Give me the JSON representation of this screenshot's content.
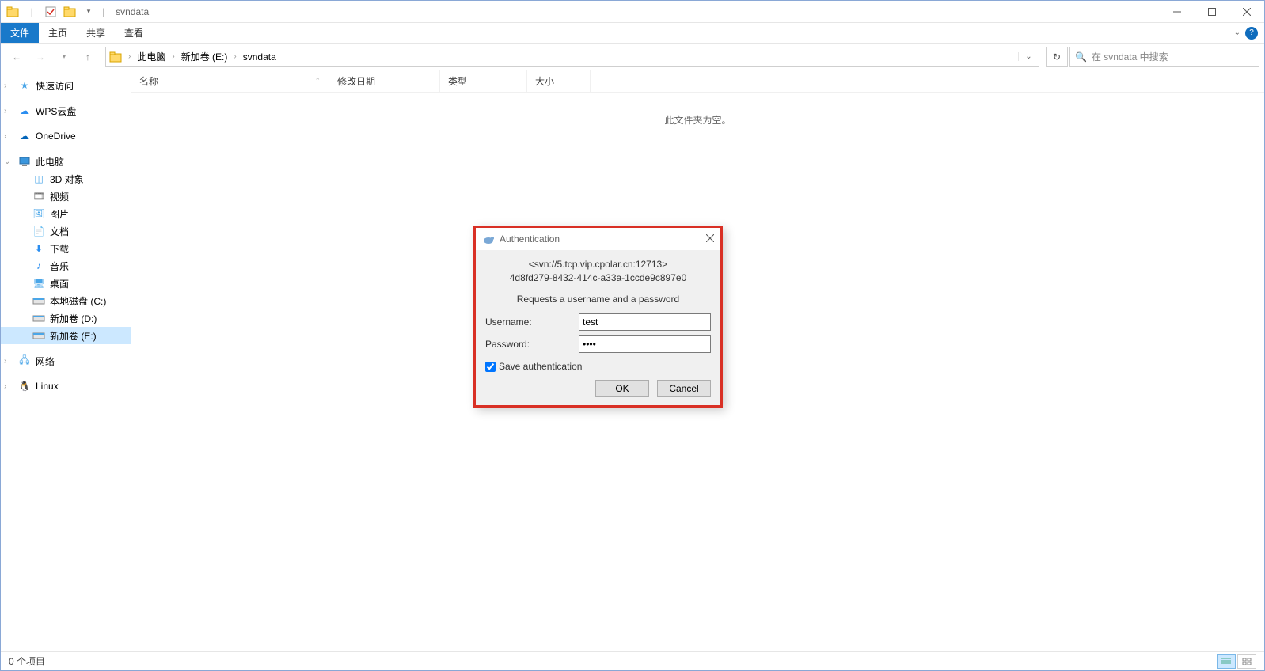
{
  "title": "svndata",
  "ribbon": {
    "file": "文件",
    "home": "主页",
    "share": "共享",
    "view": "查看"
  },
  "breadcrumb": [
    "此电脑",
    "新加卷 (E:)",
    "svndata"
  ],
  "search_placeholder": "在 svndata 中搜索",
  "columns": {
    "name": "名称",
    "modified": "修改日期",
    "type": "类型",
    "size": "大小"
  },
  "empty": "此文件夹为空。",
  "statusbar": "0 个项目",
  "nav": {
    "quickaccess": "快速访问",
    "wps": "WPS云盘",
    "onedrive": "OneDrive",
    "thispc": "此电脑",
    "objects3d": "3D 对象",
    "videos": "视频",
    "pictures": "图片",
    "documents": "文档",
    "downloads": "下载",
    "music": "音乐",
    "desktop": "桌面",
    "cdrive": "本地磁盘 (C:)",
    "ddrive": "新加卷 (D:)",
    "edrive": "新加卷 (E:)",
    "network": "网络",
    "linux": "Linux"
  },
  "dialog": {
    "title": "Authentication",
    "url": "<svn://5.tcp.vip.cpolar.cn:12713>",
    "uuid": "4d8fd279-8432-414c-a33a-1ccde9c897e0",
    "prompt": "Requests a username and a password",
    "username_label": "Username:",
    "username_value": "test",
    "password_label": "Password:",
    "password_value": "••••",
    "save_label": "Save authentication",
    "ok": "OK",
    "cancel": "Cancel"
  }
}
